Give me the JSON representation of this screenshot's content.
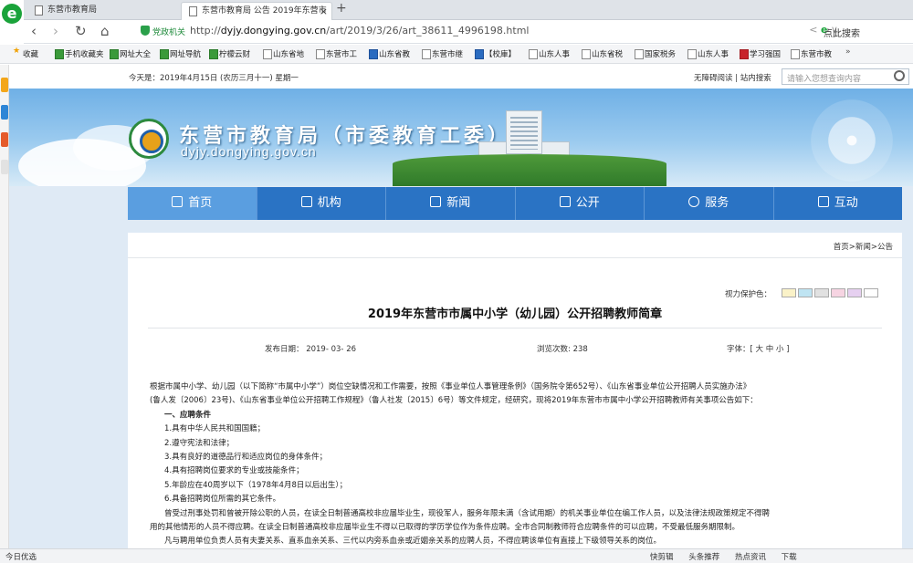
{
  "browser": {
    "tabs": [
      {
        "title": "东营市教育局"
      },
      {
        "title": "东营市教育局 公告 2019年东营市",
        "close": "×"
      }
    ],
    "new_tab": "+",
    "security_label": "党政机关",
    "url_prefix": "http://",
    "url_host": "dyjy.dongying.gov.cn",
    "url_path": "/art/2019/3/26/art_38611_4996198.html",
    "search_hint": "点此搜索",
    "bookmarks": [
      "收藏",
      "手机收藏夹",
      "网址大全",
      "网址导航",
      "柠檬云财",
      "山东省地",
      "东营市工",
      "山东省教",
      "东营市继",
      "【校庫】",
      "山东人事",
      "山东省税",
      "国家税务",
      "山东人事",
      "学习强国",
      "东营市教",
      "»"
    ],
    "status_left": "今日优选",
    "status_right": [
      "快剪辑",
      "头条推荐",
      "热点资讯",
      "下载"
    ]
  },
  "site": {
    "today": "今天是：2019年4月15日 (农历三月十一) 星期一",
    "top_links": "无障碍阅读 | 站内搜索",
    "search_placeholder": "请输入您想查询内容",
    "title": "东营市教育局（市委教育工委）",
    "domain": "dyjy.dongying.gov.cn",
    "nav": [
      {
        "label": "首页"
      },
      {
        "label": "机构"
      },
      {
        "label": "新闻"
      },
      {
        "label": "公开"
      },
      {
        "label": "服务"
      },
      {
        "label": "互动"
      }
    ]
  },
  "article": {
    "breadcrumb": "首页>新闻>公告",
    "eyecare_label": "视力保护色：",
    "eyecare_colors": [
      "#faf2c8",
      "#bfe4f2",
      "#e1e1e1",
      "#f6d4e2",
      "#e6d0f0",
      "#ffffff"
    ],
    "title": "2019年东营市市属中小学（幼儿园）公开招聘教师简章",
    "publish_date": "发布日期： 2019- 03- 26",
    "views": "浏览次数: 238",
    "font_size": "字体：[ 大 中 小 ]",
    "paragraphs": [
      "根据市属中小学、幼儿园（以下简称“市属中小学”）岗位空缺情况和工作需要，按照《事业单位人事管理条例》（国务院令第652号）、《山东省事业单位公开招聘人员实施办法》",
      "(鲁人发〔2006〕23号)、《山东省事业单位公开招聘工作规程》（鲁人社发〔2015〕6号）等文件规定，经研究，现将2019年东营市市属中小学公开招聘教师有关事项公告如下：",
      "一、应聘条件",
      "1.具有中华人民共和国国籍；",
      "2.遵守宪法和法律；",
      "3.具有良好的道德品行和适应岗位的身体条件；",
      "4.具有招聘岗位要求的专业或技能条件；",
      "5.年龄应在40周岁以下（1978年4月8日以后出生）；",
      "6.具备招聘岗位所需的其它条件。",
      "曾受过刑事处罚和曾被开除公职的人员，在读全日制普通高校非应届毕业生，现役军人，服务年限未满（含试用期）的机关事业单位在编工作人员，以及法律法规政策规定不得聘",
      "用的其他情形的人员不得应聘。在读全日制普通高校非应届毕业生不得以已取得的学历学位作为条件应聘。全市合同制教师符合应聘条件的可以应聘，不受最低服务期限制。",
      "凡与聘用单位负责人员有夫妻关系、直系血亲关系、三代以内旁系血亲或近姻亲关系的应聘人员，不得应聘该单位有直接上下级领导关系的岗位。"
    ]
  }
}
